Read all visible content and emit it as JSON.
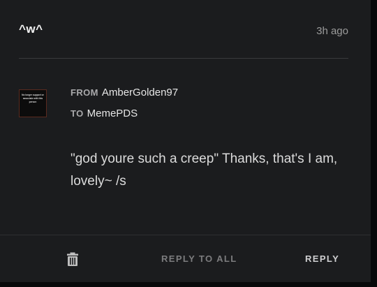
{
  "header": {
    "title": "^w^",
    "timestamp": "3h ago"
  },
  "avatar": {
    "text": "No longer support or associate with this person"
  },
  "message": {
    "from_label": "FROM",
    "from_value": "AmberGolden97",
    "to_label": "TO",
    "to_value": "MemePDS",
    "body": "\"god youre such a creep\" Thanks, that's I am, lovely~ /s"
  },
  "footer": {
    "reply_all_label": "REPLY TO ALL",
    "reply_label": "REPLY"
  },
  "icons": {
    "delete": "trash-icon"
  }
}
